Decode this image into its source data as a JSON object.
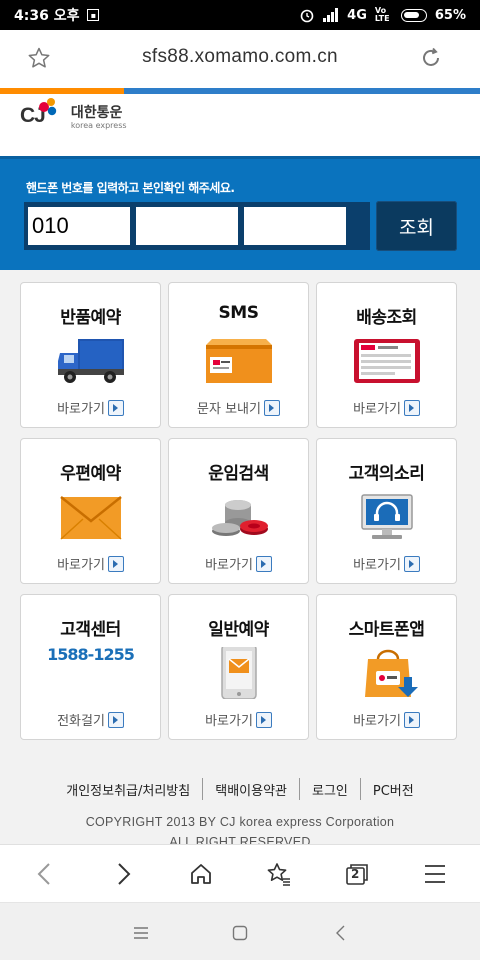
{
  "status_bar": {
    "time": "4:36 오후",
    "network": "4G",
    "volte": "Vo LTE",
    "battery": "65%"
  },
  "browser": {
    "url": "sfs88.xomamo.com.cn",
    "tab_count": "2"
  },
  "logo": {
    "brand": "CJ",
    "korean": "대한통운",
    "english": "korea express"
  },
  "search": {
    "instruction": "핸드폰 번호를 입력하고 본인확인 해주세요.",
    "phone_part1": "010",
    "phone_part2": "",
    "phone_part3": "",
    "button_label": "조회"
  },
  "cards": [
    {
      "title": "반품예약",
      "link": "바로가기",
      "icon": "truck-icon"
    },
    {
      "title": "SMS",
      "link": "문자 보내기",
      "icon": "package-box-icon"
    },
    {
      "title": "배송조회",
      "link": "바로가기",
      "icon": "tracking-screen-icon"
    },
    {
      "title": "우편예약",
      "link": "바로가기",
      "icon": "envelope-icon"
    },
    {
      "title": "운임검색",
      "link": "바로가기",
      "icon": "coins-icon"
    },
    {
      "title": "고객의소리",
      "link": "바로가기",
      "icon": "headset-monitor-icon"
    },
    {
      "title": "고객센터",
      "phone": "1588-1255",
      "link": "전화걸기",
      "icon": ""
    },
    {
      "title": "일반예약",
      "link": "바로가기",
      "icon": "mobile-mail-icon"
    },
    {
      "title": "스마트폰앱",
      "link": "바로가기",
      "icon": "app-download-icon"
    }
  ],
  "footer": {
    "links": [
      "개인정보취급/처리방침",
      "택배이용약관",
      "로그인",
      "PC버전"
    ],
    "copyright_line1": "COPYRIGHT 2013 BY CJ korea express Corporation",
    "copyright_line2": "ALL RIGHT RESERVED"
  },
  "colors": {
    "panel_blue": "#0a73be",
    "accent_orange": "#ff8c00",
    "phone_blue": "#1a6fb8"
  }
}
